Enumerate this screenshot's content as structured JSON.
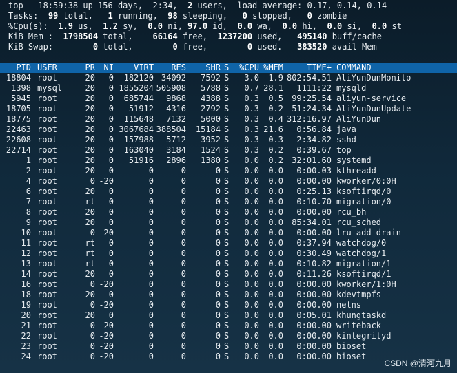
{
  "summary": {
    "uptime": "top - 18:59:38 up 156 days,  2:34,",
    "users": "2",
    "users_label": " users,  load average: 0.17, 0.14, 0.14",
    "tasks_label": "Tasks:",
    "tasks_total": "99",
    "tasks_total_label": " total,",
    "tasks_running": "1",
    "tasks_running_label": " running,",
    "tasks_sleeping": "98",
    "tasks_sleeping_label": " sleeping,",
    "tasks_stopped": "0",
    "tasks_stopped_label": " stopped,",
    "tasks_zombie": "0",
    "tasks_zombie_label": " zombie",
    "cpu_label": "%Cpu(s):",
    "cpu_us": "1.9",
    "cpu_us_label": " us,",
    "cpu_sy": "1.2",
    "cpu_sy_label": " sy,",
    "cpu_ni": "0.0",
    "cpu_ni_label": " ni,",
    "cpu_id": "97.0",
    "cpu_id_label": " id,",
    "cpu_wa": "0.0",
    "cpu_wa_label": " wa,",
    "cpu_hi": "0.0",
    "cpu_hi_label": " hi,",
    "cpu_si": "0.0",
    "cpu_si_label": " si,",
    "cpu_st": "0.0",
    "cpu_st_label": " st",
    "mem_label": "KiB Mem :",
    "mem_total": "1798504",
    "mem_total_label": " total,",
    "mem_free": "66164",
    "mem_free_label": " free,",
    "mem_used": "1237200",
    "mem_used_label": " used,",
    "mem_buff": "495140",
    "mem_buff_label": " buff/cache",
    "swap_label": "KiB Swap:",
    "swap_total": "0",
    "swap_total_label": " total,",
    "swap_free": "0",
    "swap_free_label": " free,",
    "swap_used": "0",
    "swap_used_label": " used.",
    "swap_avail": "383520",
    "swap_avail_label": " avail Mem"
  },
  "columns": [
    "PID",
    "USER",
    "PR",
    "NI",
    "VIRT",
    "RES",
    "SHR",
    "S",
    "%CPU",
    "%MEM",
    "TIME+",
    "COMMAND"
  ],
  "processes": [
    [
      "18804",
      "root",
      "20",
      "0",
      "182120",
      "34092",
      "7592",
      "S",
      "3.0",
      "1.9",
      "802:54.51",
      "AliYunDunMonito"
    ],
    [
      "1398",
      "mysql",
      "20",
      "0",
      "1855204",
      "505908",
      "5788",
      "S",
      "0.7",
      "28.1",
      "1111:22",
      "mysqld"
    ],
    [
      "5945",
      "root",
      "20",
      "0",
      "685744",
      "9868",
      "4388",
      "S",
      "0.3",
      "0.5",
      "99:25.54",
      "aliyun-service"
    ],
    [
      "18705",
      "root",
      "20",
      "0",
      "51912",
      "4316",
      "2792",
      "S",
      "0.3",
      "0.2",
      "51:24.34",
      "AliYunDunUpdate"
    ],
    [
      "18775",
      "root",
      "20",
      "0",
      "115648",
      "7132",
      "5000",
      "S",
      "0.3",
      "0.4",
      "312:16.97",
      "AliYunDun"
    ],
    [
      "22463",
      "root",
      "20",
      "0",
      "3067684",
      "388504",
      "15184",
      "S",
      "0.3",
      "21.6",
      "0:56.84",
      "java"
    ],
    [
      "22608",
      "root",
      "20",
      "0",
      "157988",
      "5712",
      "3952",
      "S",
      "0.3",
      "0.3",
      "2:34.82",
      "sshd"
    ],
    [
      "22714",
      "root",
      "20",
      "0",
      "163040",
      "3184",
      "1524",
      "S",
      "0.3",
      "0.2",
      "0:39.67",
      "top"
    ],
    [
      "1",
      "root",
      "20",
      "0",
      "51916",
      "2896",
      "1380",
      "S",
      "0.0",
      "0.2",
      "32:01.60",
      "systemd"
    ],
    [
      "2",
      "root",
      "20",
      "0",
      "0",
      "0",
      "0",
      "S",
      "0.0",
      "0.0",
      "0:00.03",
      "kthreadd"
    ],
    [
      "4",
      "root",
      "0",
      "-20",
      "0",
      "0",
      "0",
      "S",
      "0.0",
      "0.0",
      "0:00.00",
      "kworker/0:0H"
    ],
    [
      "6",
      "root",
      "20",
      "0",
      "0",
      "0",
      "0",
      "S",
      "0.0",
      "0.0",
      "0:25.13",
      "ksoftirqd/0"
    ],
    [
      "7",
      "root",
      "rt",
      "0",
      "0",
      "0",
      "0",
      "S",
      "0.0",
      "0.0",
      "0:10.70",
      "migration/0"
    ],
    [
      "8",
      "root",
      "20",
      "0",
      "0",
      "0",
      "0",
      "S",
      "0.0",
      "0.0",
      "0:00.00",
      "rcu_bh"
    ],
    [
      "9",
      "root",
      "20",
      "0",
      "0",
      "0",
      "0",
      "S",
      "0.0",
      "0.0",
      "85:34.01",
      "rcu_sched"
    ],
    [
      "10",
      "root",
      "0",
      "-20",
      "0",
      "0",
      "0",
      "S",
      "0.0",
      "0.0",
      "0:00.00",
      "lru-add-drain"
    ],
    [
      "11",
      "root",
      "rt",
      "0",
      "0",
      "0",
      "0",
      "S",
      "0.0",
      "0.0",
      "0:37.94",
      "watchdog/0"
    ],
    [
      "12",
      "root",
      "rt",
      "0",
      "0",
      "0",
      "0",
      "S",
      "0.0",
      "0.0",
      "0:30.49",
      "watchdog/1"
    ],
    [
      "13",
      "root",
      "rt",
      "0",
      "0",
      "0",
      "0",
      "S",
      "0.0",
      "0.0",
      "0:10.82",
      "migration/1"
    ],
    [
      "14",
      "root",
      "20",
      "0",
      "0",
      "0",
      "0",
      "S",
      "0.0",
      "0.0",
      "0:11.26",
      "ksoftirqd/1"
    ],
    [
      "16",
      "root",
      "0",
      "-20",
      "0",
      "0",
      "0",
      "S",
      "0.0",
      "0.0",
      "0:00.00",
      "kworker/1:0H"
    ],
    [
      "18",
      "root",
      "20",
      "0",
      "0",
      "0",
      "0",
      "S",
      "0.0",
      "0.0",
      "0:00.00",
      "kdevtmpfs"
    ],
    [
      "19",
      "root",
      "0",
      "-20",
      "0",
      "0",
      "0",
      "S",
      "0.0",
      "0.0",
      "0:00.00",
      "netns"
    ],
    [
      "20",
      "root",
      "20",
      "0",
      "0",
      "0",
      "0",
      "S",
      "0.0",
      "0.0",
      "0:05.01",
      "khungtaskd"
    ],
    [
      "21",
      "root",
      "0",
      "-20",
      "0",
      "0",
      "0",
      "S",
      "0.0",
      "0.0",
      "0:00.00",
      "writeback"
    ],
    [
      "22",
      "root",
      "0",
      "-20",
      "0",
      "0",
      "0",
      "S",
      "0.0",
      "0.0",
      "0:00.00",
      "kintegrityd"
    ],
    [
      "23",
      "root",
      "0",
      "-20",
      "0",
      "0",
      "0",
      "S",
      "0.0",
      "0.0",
      "0:00.00",
      "bioset"
    ],
    [
      "24",
      "root",
      "0",
      "-20",
      "0",
      "0",
      "0",
      "S",
      "0.0",
      "0.0",
      "0:00.00",
      "bioset"
    ]
  ],
  "watermark": "CSDN @清河九月",
  "colors": {
    "background": "#10293b",
    "header_bar": "#0f64a8",
    "text": "#e6ebef"
  }
}
